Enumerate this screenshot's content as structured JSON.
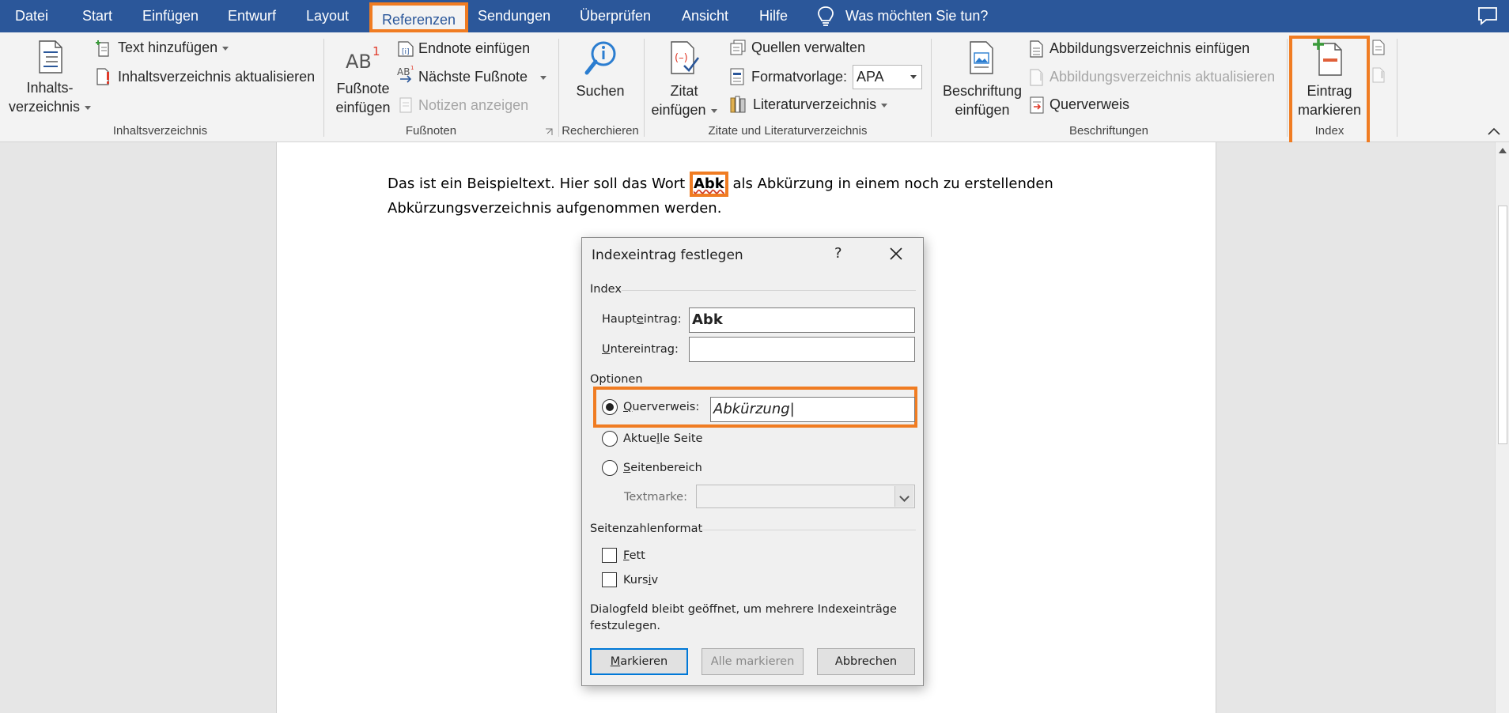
{
  "tabs": {
    "datei": "Datei",
    "start": "Start",
    "einfuegen": "Einfügen",
    "entwurf": "Entwurf",
    "layout": "Layout",
    "referenzen": "Referenzen",
    "sendungen": "Sendungen",
    "ueberpruefen": "Überprüfen",
    "ansicht": "Ansicht",
    "hilfe": "Hilfe",
    "tell_me": "Was möchten Sie tun?"
  },
  "ribbon": {
    "toc": {
      "big_line1": "Inhalts-",
      "big_line2": "verzeichnis",
      "add_text": "Text hinzufügen",
      "update": "Inhaltsverzeichnis aktualisieren",
      "group": "Inhaltsverzeichnis"
    },
    "footnotes": {
      "big_line1": "Fußnote",
      "big_line2": "einfügen",
      "endnote": "Endnote einfügen",
      "next": "Nächste Fußnote",
      "show_notes": "Notizen anzeigen",
      "group": "Fußnoten"
    },
    "research": {
      "search": "Suchen",
      "group": "Recherchieren"
    },
    "citations": {
      "big_line1": "Zitat",
      "big_line2": "einfügen",
      "manage": "Quellen verwalten",
      "style_label": "Formatvorlage:",
      "style_value": "APA",
      "bibliography": "Literaturverzeichnis",
      "group": "Zitate und Literaturverzeichnis"
    },
    "captions": {
      "big_line1": "Beschriftung",
      "big_line2": "einfügen",
      "insert_tof": "Abbildungsverzeichnis einfügen",
      "update_tof": "Abbildungsverzeichnis aktualisieren",
      "crossref": "Querverweis",
      "group": "Beschriftungen"
    },
    "index": {
      "big_line1": "Eintrag",
      "big_line2": "markieren",
      "group": "Index"
    }
  },
  "document": {
    "before": "Das ist ein Beispieltext. Hier soll das Wort ",
    "highlight": "Abk",
    "after": " als Abkürzung in einem noch zu erstellenden Abkürzungsverzeichnis aufgenommen werden."
  },
  "dialog": {
    "title": "Indexeintrag festlegen",
    "help": "?",
    "section_index": "Index",
    "main_entry_pre": "Haupt",
    "main_entry_ul": "e",
    "main_entry_post": "intrag:",
    "main_entry_value": "Abk",
    "sub_entry_ul": "U",
    "sub_entry_post": "ntereintrag:",
    "sub_entry_value": "",
    "section_options": "Optionen",
    "crossref_ul": "Q",
    "crossref_post": "uerverweis:",
    "crossref_value": "Abkürzung",
    "current_page_pre": "Aktue",
    "current_page_ul": "l",
    "current_page_post": "le Seite",
    "page_range_ul": "S",
    "page_range_post": "eitenbereich",
    "bookmark_label": "Textmarke:",
    "section_format": "Seitenzahlenformat",
    "bold_ul": "F",
    "bold_post": "ett",
    "italic_pre": "Kurs",
    "italic_ul": "i",
    "italic_post": "v",
    "info": "Dialogfeld bleibt geöffnet, um mehrere Indexeinträge festzulegen.",
    "btn_mark_ul": "M",
    "btn_mark_post": "arkieren",
    "btn_mark_all": "Alle markieren",
    "btn_cancel": "Abbrechen"
  },
  "colors": {
    "accent": "#2b579a",
    "highlight_outline": "#f07c22"
  }
}
